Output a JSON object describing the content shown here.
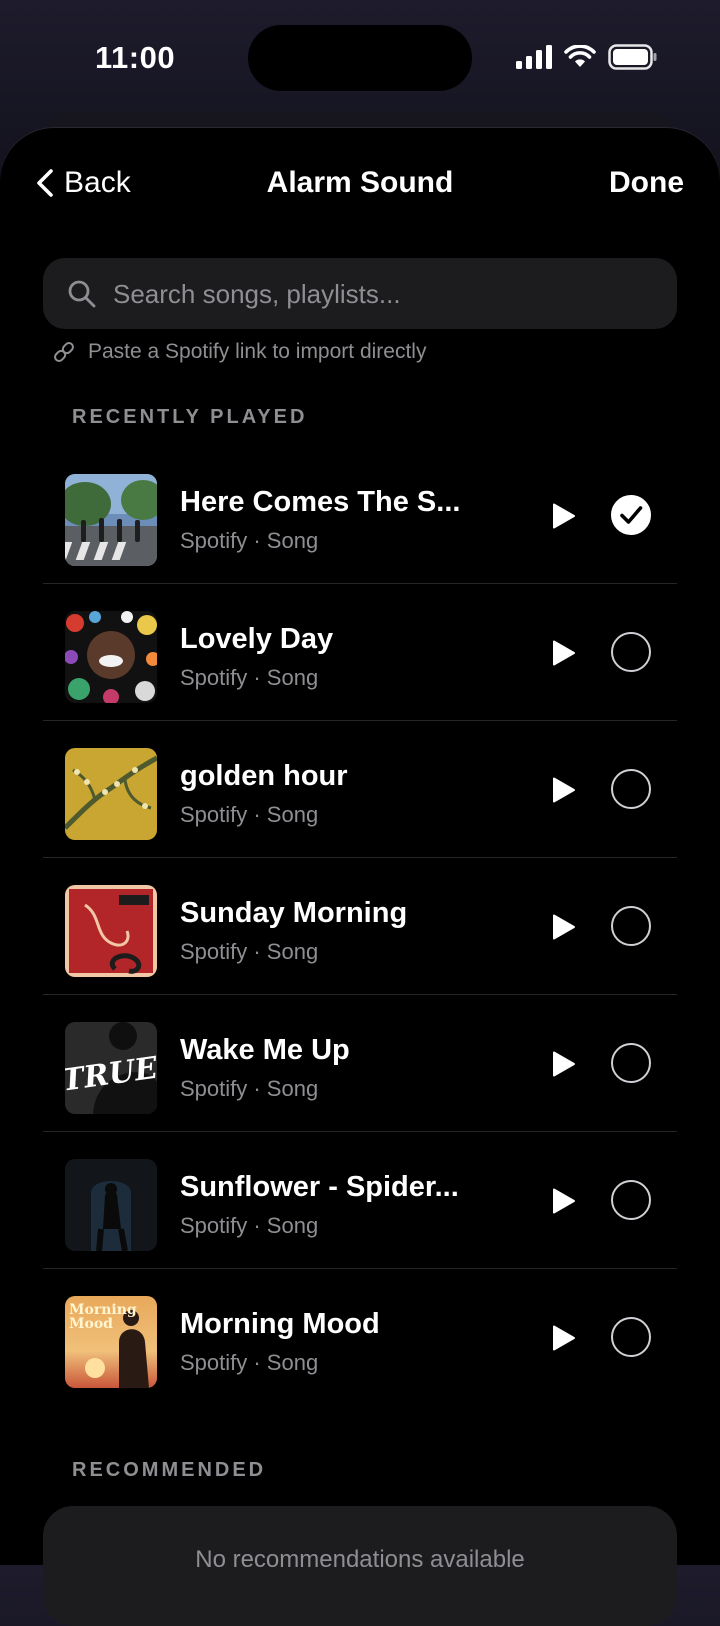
{
  "status_bar": {
    "time": "11:00"
  },
  "nav": {
    "back_label": "Back",
    "title": "Alarm Sound",
    "done_label": "Done"
  },
  "search": {
    "placeholder": "Search songs, playlists..."
  },
  "spotify_hint": "Paste a Spotify link to import directly",
  "sections": {
    "recent": "RECENTLY PLAYED",
    "recommended": "RECOMMENDED"
  },
  "recent": [
    {
      "title": "Here Comes The S...",
      "subtitle": "Spotify · Song",
      "selected": true
    },
    {
      "title": "Lovely Day",
      "subtitle": "Spotify · Song",
      "selected": false
    },
    {
      "title": "golden hour",
      "subtitle": "Spotify · Song",
      "selected": false
    },
    {
      "title": "Sunday Morning",
      "subtitle": "Spotify · Song",
      "selected": false
    },
    {
      "title": "Wake Me Up",
      "subtitle": "Spotify · Song",
      "selected": false
    },
    {
      "title": "Sunflower - Spider...",
      "subtitle": "Spotify · Song",
      "selected": false
    },
    {
      "title": "Morning Mood",
      "subtitle": "Spotify · Song",
      "selected": false
    }
  ],
  "art_text": {
    "wake_me_up": "TRUE",
    "morning_mood": "Morning Mood"
  },
  "recommended_empty": "No recommendations available",
  "colors": {
    "background": "#000000",
    "card": "#1c1c1e",
    "secondary_text": "#8e8e93"
  }
}
